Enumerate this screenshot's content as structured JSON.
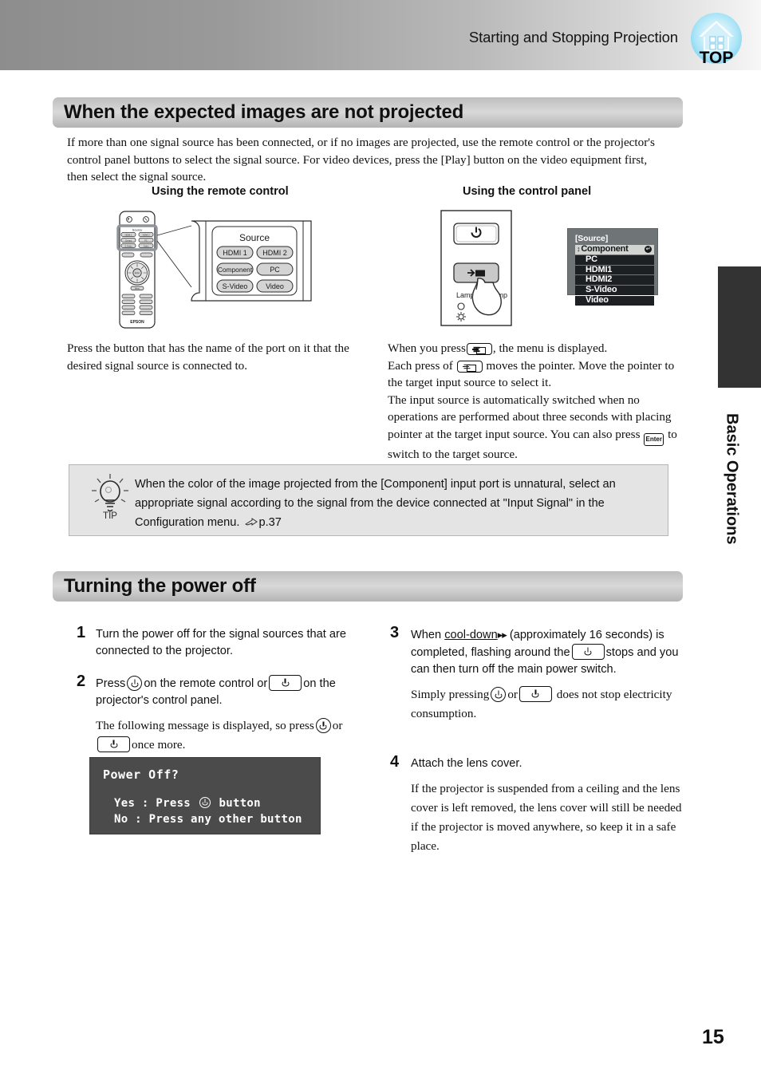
{
  "header": {
    "title": "Starting and Stopping Projection",
    "top_badge": {
      "label": "TOP",
      "icon": "home-top-icon"
    }
  },
  "side_tab": {
    "label": "Basic Operations"
  },
  "page_number": "15",
  "sections": [
    {
      "id": "expected-images",
      "heading": "When the expected images are not projected",
      "intro": "If more than one signal source has been connected, or if no images are projected, use the remote control or the projector's control panel buttons to select the signal source. For video devices, press the [Play] button on the video equipment first, then select the signal source.",
      "columns": {
        "remote": {
          "label": "Using the remote control",
          "figure": {
            "caption": "Source",
            "brand": "EPSON",
            "buttons": [
              "HDMI 1",
              "HDMI 2",
              "Component",
              "PC",
              "S-Video",
              "Video"
            ]
          },
          "text": "Press the button that has the name of the port on it that the desired signal source is connected to."
        },
        "panel": {
          "label": "Using the control panel",
          "figure": {
            "lamp_label": "Lamp",
            "temp_label": "Temp"
          },
          "osd": {
            "title": "[Source]",
            "selected": "Component",
            "items": [
              "Component",
              "PC",
              "HDMI1",
              "HDMI2",
              "S-Video",
              "Video"
            ]
          },
          "text_parts": {
            "l1a": "When you press",
            "l1b": ", the menu is displayed.",
            "l2a": "Each press of",
            "l2b": "moves the pointer. Move the pointer to the target input source to select it.",
            "l3": "The input source is automatically switched when no operations are performed about three seconds with placing pointer at the target input source. You can also press",
            "enter_key": "Enter",
            "l4": "to switch to the target source."
          }
        }
      },
      "tip": {
        "label": "TIP",
        "text": "When the color of the image projected from the [Component] input port is unnatural, select an appropriate signal according to the signal from the device connected at \"Input Signal\" in the Configuration menu.",
        "reference": "p.37"
      }
    },
    {
      "id": "turning-power-off",
      "heading": "Turning the power off",
      "steps": [
        {
          "number": "1",
          "text": "Turn the power off for the signal sources that are connected to the projector."
        },
        {
          "number": "2",
          "text_a": "Press",
          "text_b": "on the remote control or",
          "text_c": "on the projector's control panel.",
          "sub_a": "The following message is displayed, so press",
          "sub_b": "or",
          "sub_c": "once more."
        },
        {
          "number": "3",
          "text_a": "When",
          "term": "cool-down",
          "text_b": "(approximately 16 seconds) is completed, flashing around the",
          "text_c": "stops and you can then turn off the main power switch.",
          "sub_a": "Simply pressing",
          "sub_b": "or",
          "sub_c": "does not stop electricity consumption."
        },
        {
          "number": "4",
          "text": "Attach the lens cover.",
          "sub": "If the projector is suspended from a ceiling and the lens cover is left removed, the lens cover will still be needed if the projector is moved anywhere, so keep it in a safe place."
        }
      ],
      "dialog": {
        "title": "Power Off?",
        "yes_label": "Yes :",
        "yes_text_a": "Press",
        "yes_text_b": "button",
        "no_label": "No  :",
        "no_text": "Press any other button"
      }
    }
  ],
  "colors": {
    "header_gradient_start": "#8d8d8d",
    "header_gradient_end": "#f7f7f7",
    "section_bar": "#c9c9c9",
    "tip_box_bg": "#e4e4e4",
    "osd_frame": "#6f7477",
    "osd_row_bg": "#1d2022",
    "osd_selected_bg": "#d2d4d2",
    "dialog_bg": "#4b4b4b",
    "side_tab": "#333333",
    "badge_blue": "#7fd3f0"
  }
}
